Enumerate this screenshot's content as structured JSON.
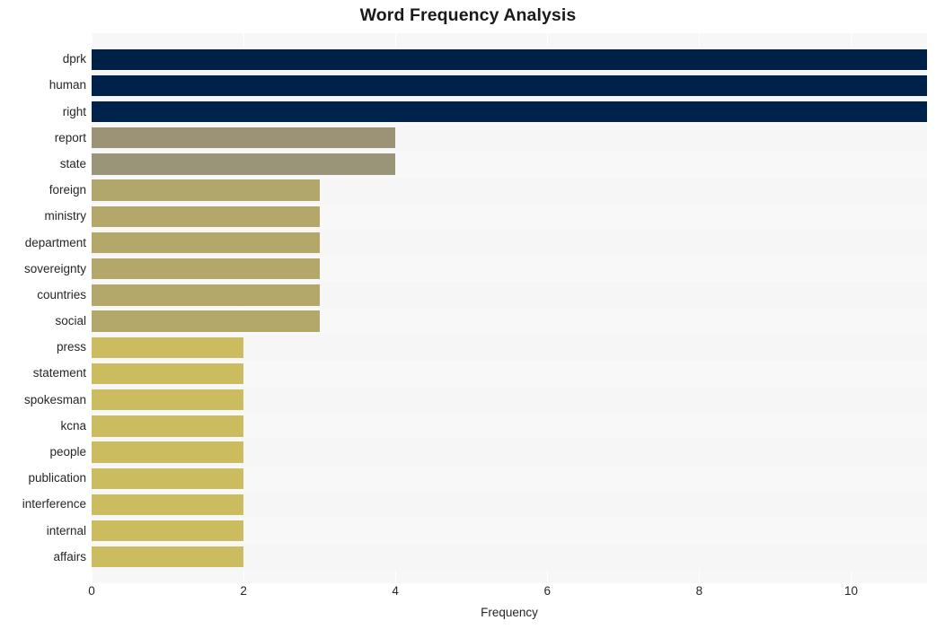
{
  "chart_data": {
    "type": "bar",
    "orientation": "horizontal",
    "title": "Word Frequency Analysis",
    "xlabel": "Frequency",
    "ylabel": "",
    "xlim": [
      0,
      11
    ],
    "ylim": null,
    "grid": true,
    "legend": null,
    "xticks": [
      0,
      2,
      4,
      6,
      8,
      10
    ],
    "xtick_labels": [
      "0",
      "2",
      "4",
      "6",
      "8",
      "10"
    ],
    "categories": [
      "dprk",
      "human",
      "right",
      "report",
      "state",
      "foreign",
      "ministry",
      "department",
      "sovereignty",
      "countries",
      "social",
      "press",
      "statement",
      "spokesman",
      "kcna",
      "people",
      "publication",
      "interference",
      "internal",
      "affairs"
    ],
    "values": [
      11,
      11,
      11,
      4,
      4,
      3,
      3,
      3,
      3,
      3,
      3,
      2,
      2,
      2,
      2,
      2,
      2,
      2,
      2,
      2
    ],
    "bar_colors": [
      "#002147",
      "#00224a",
      "#00234b",
      "#9c9377",
      "#9a9478",
      "#b2a76a",
      "#b3a86a",
      "#b3a86a",
      "#b3a86a",
      "#b3a86a",
      "#b3a86a",
      "#cbbc60",
      "#cbbc60",
      "#cbbc60",
      "#cbbc60",
      "#cbbc60",
      "#cbbc60",
      "#cbbc60",
      "#cbbc60",
      "#cbbc60"
    ],
    "plot_background": "#f7f7f7",
    "gridline_color": "#ffffff",
    "figure_background": "#ffffff",
    "text_color": "#262626"
  },
  "axes": {
    "x_tick_labels": [
      "0",
      "2",
      "4",
      "6",
      "8",
      "10"
    ],
    "x_axis_title": "Frequency"
  },
  "header": {
    "title": "Word Frequency Analysis"
  }
}
